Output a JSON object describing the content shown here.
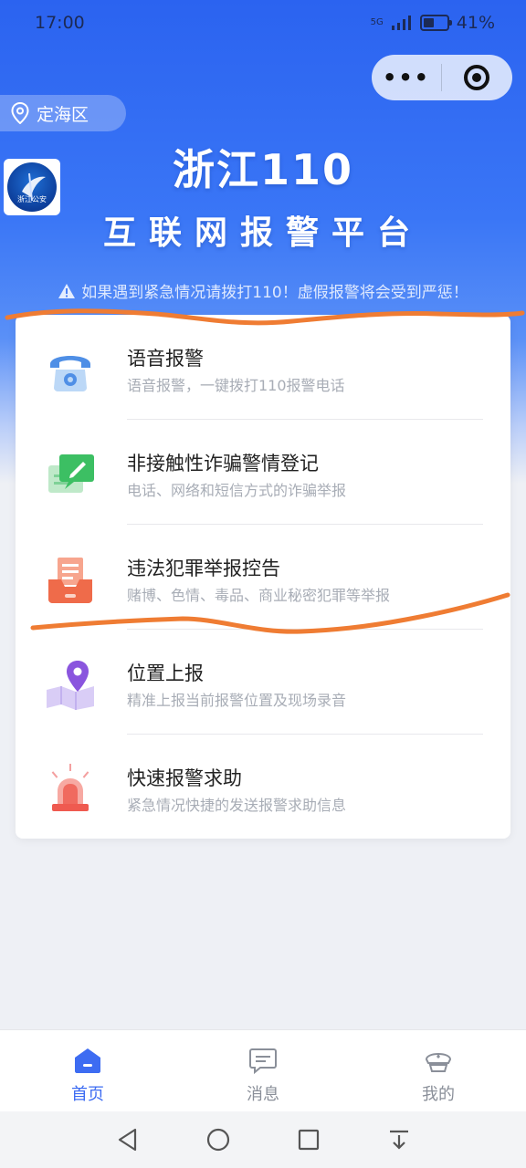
{
  "status_bar": {
    "time": "17:00",
    "network": "5G",
    "battery": "41%"
  },
  "header": {
    "location": "定海区",
    "logo_text": "浙江公安",
    "title": "浙江110",
    "subtitle": "互联网报警平台",
    "warning": "如果遇到紧急情况请拨打110！虚假报警将会受到严惩！"
  },
  "menu": [
    {
      "title": "语音报警",
      "subtitle": "语音报警，一键拨打110报警电话",
      "icon": "telephone-icon",
      "color": "#5a9bea"
    },
    {
      "title": "非接触性诈骗警情登记",
      "subtitle": "电话、网络和短信方式的诈骗举报",
      "icon": "edit-message-icon",
      "color": "#3fc46a"
    },
    {
      "title": "违法犯罪举报控告",
      "subtitle": "赌博、色情、毒品、商业秘密犯罪等举报",
      "icon": "report-tray-icon",
      "color": "#f07a5a"
    },
    {
      "title": "位置上报",
      "subtitle": "精准上报当前报警位置及现场录音",
      "icon": "location-map-icon",
      "color": "#8b5be0"
    },
    {
      "title": "快速报警求助",
      "subtitle": "紧急情况快捷的发送报警求助信息",
      "icon": "siren-icon",
      "color": "#f06060"
    }
  ],
  "tabs": [
    {
      "label": "首页",
      "icon": "home-icon",
      "active": true
    },
    {
      "label": "消息",
      "icon": "message-icon",
      "active": false
    },
    {
      "label": "我的",
      "icon": "profile-icon",
      "active": false
    }
  ],
  "accent_color": "#3d6cf2"
}
